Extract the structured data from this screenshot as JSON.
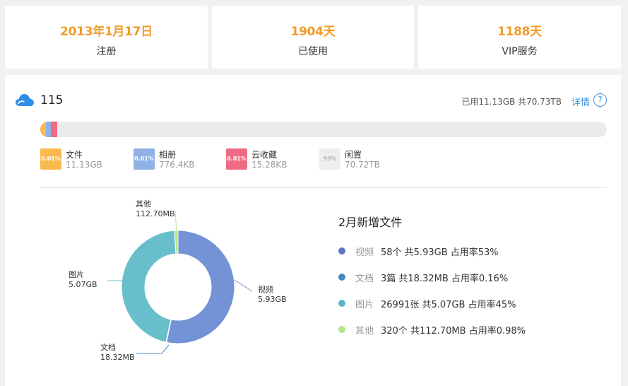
{
  "stats": [
    {
      "value": "2013年1月17日",
      "label": "注册"
    },
    {
      "value": "1904天",
      "label": "已使用"
    },
    {
      "value": "1188天",
      "label": "VIP服务"
    }
  ],
  "storage": {
    "brand": "115",
    "usage": "已用11.13GB 共70.73TB",
    "detail_link": "详情",
    "help_icon_glyph": "?"
  },
  "legend": [
    {
      "name": "文件",
      "percent": "0.01%",
      "size": "11.13GB",
      "color": "#f9b94e"
    },
    {
      "name": "相册",
      "percent": "0.01%",
      "size": "776.4KB",
      "color": "#8fb1e6"
    },
    {
      "name": "云收藏",
      "percent": "0.01%",
      "size": "15.28KB",
      "color": "#ef6b83"
    },
    {
      "name": "闲置",
      "percent": "99%",
      "size": "70.72TB",
      "color": "#eeeeee"
    }
  ],
  "chart_data": {
    "type": "pie",
    "donut": true,
    "title": "2月新增文件",
    "slices": [
      {
        "name": "视频",
        "value_gb": 5.93,
        "label": "5.93GB",
        "share": 53,
        "color": "#7393d6"
      },
      {
        "name": "文档",
        "value_gb": 0.01832,
        "label": "18.32MB",
        "share": 0.16,
        "color": "#4a88c2"
      },
      {
        "name": "图片",
        "value_gb": 5.07,
        "label": "5.07GB",
        "share": 45,
        "color": "#68bfcb"
      },
      {
        "name": "其他",
        "value_gb": 0.1127,
        "label": "112.70MB",
        "share": 0.98,
        "color": "#b5e68a"
      }
    ]
  },
  "monthly": {
    "title": "2月新增文件",
    "rows": [
      {
        "category": "视频",
        "stat": "58个  共5.93GB  占用率53%",
        "color": "#5b76cc"
      },
      {
        "category": "文档",
        "stat": "3篇  共18.32MB  占用率0.16%",
        "color": "#4a88c2"
      },
      {
        "category": "图片",
        "stat": "26991张  共5.07GB  占用率45%",
        "color": "#58b8c6"
      },
      {
        "category": "其他",
        "stat": "320个  共112.70MB  占用率0.98%",
        "color": "#b5e68a"
      }
    ]
  }
}
